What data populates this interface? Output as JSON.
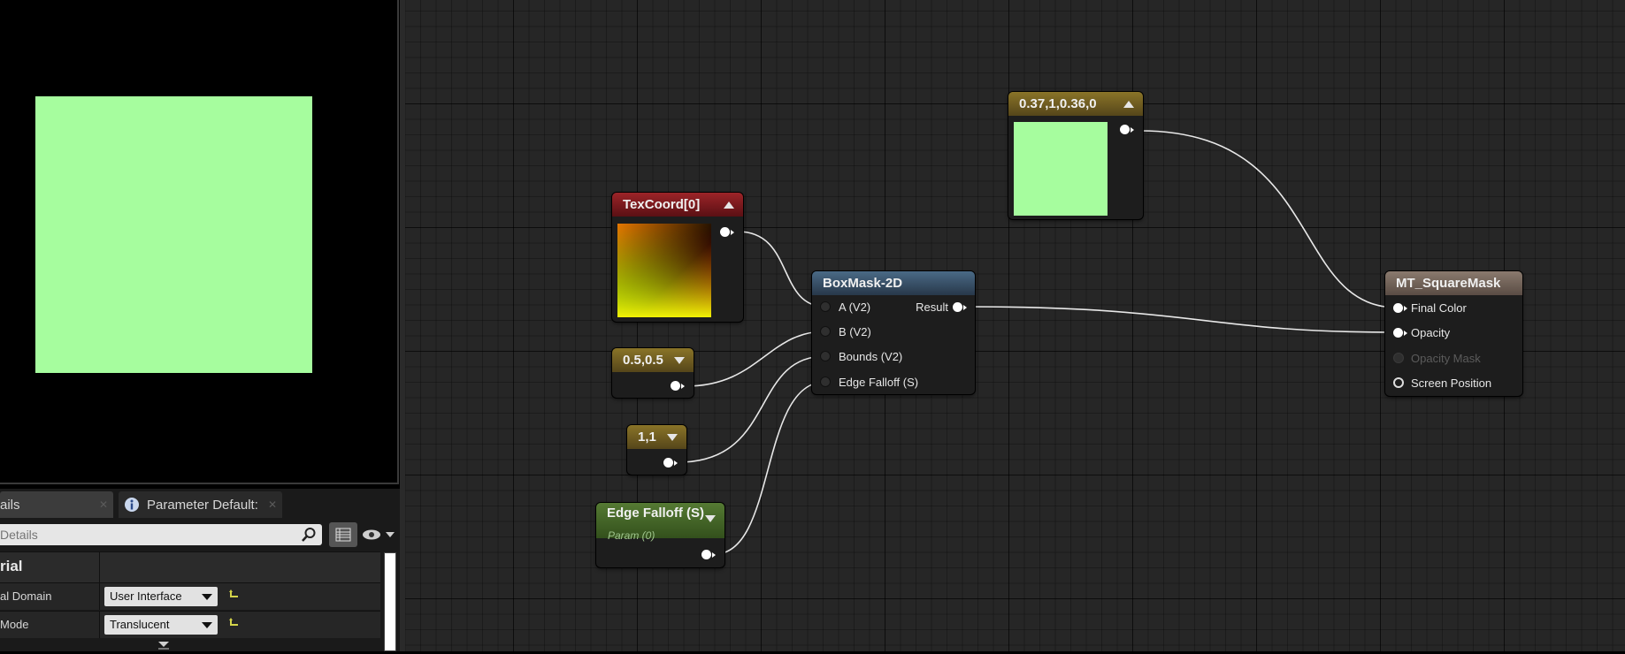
{
  "details_panel": {
    "tab_details_label": "ails",
    "tab_params_label": "Parameter Default:",
    "search_placeholder": "Details",
    "category_label": "rial",
    "properties": [
      {
        "label": "al Domain",
        "value": "User Interface"
      },
      {
        "label": "Mode",
        "value": "Translucent"
      }
    ]
  },
  "graph": {
    "nodes": {
      "texcoord": {
        "title": "TexCoord[0]"
      },
      "constant_color": {
        "title": "0.37,1,0.36,0",
        "color": "#a6fd9e"
      },
      "boxmask": {
        "title": "BoxMask-2D",
        "inputs": [
          "A (V2)",
          "B (V2)",
          "Bounds (V2)",
          "Edge Falloff (S)"
        ],
        "output": "Result"
      },
      "const_05": {
        "title": "0.5,0.5"
      },
      "const_11": {
        "title": "1,1"
      },
      "edge_falloff_param": {
        "title": "Edge Falloff (S)",
        "subtitle": "Param (0)"
      },
      "material_output": {
        "title": "MT_SquareMask",
        "inputs": [
          "Final Color",
          "Opacity",
          "Opacity Mask",
          "Screen Position"
        ]
      }
    }
  },
  "preview": {
    "color": "#a6fd9e"
  }
}
